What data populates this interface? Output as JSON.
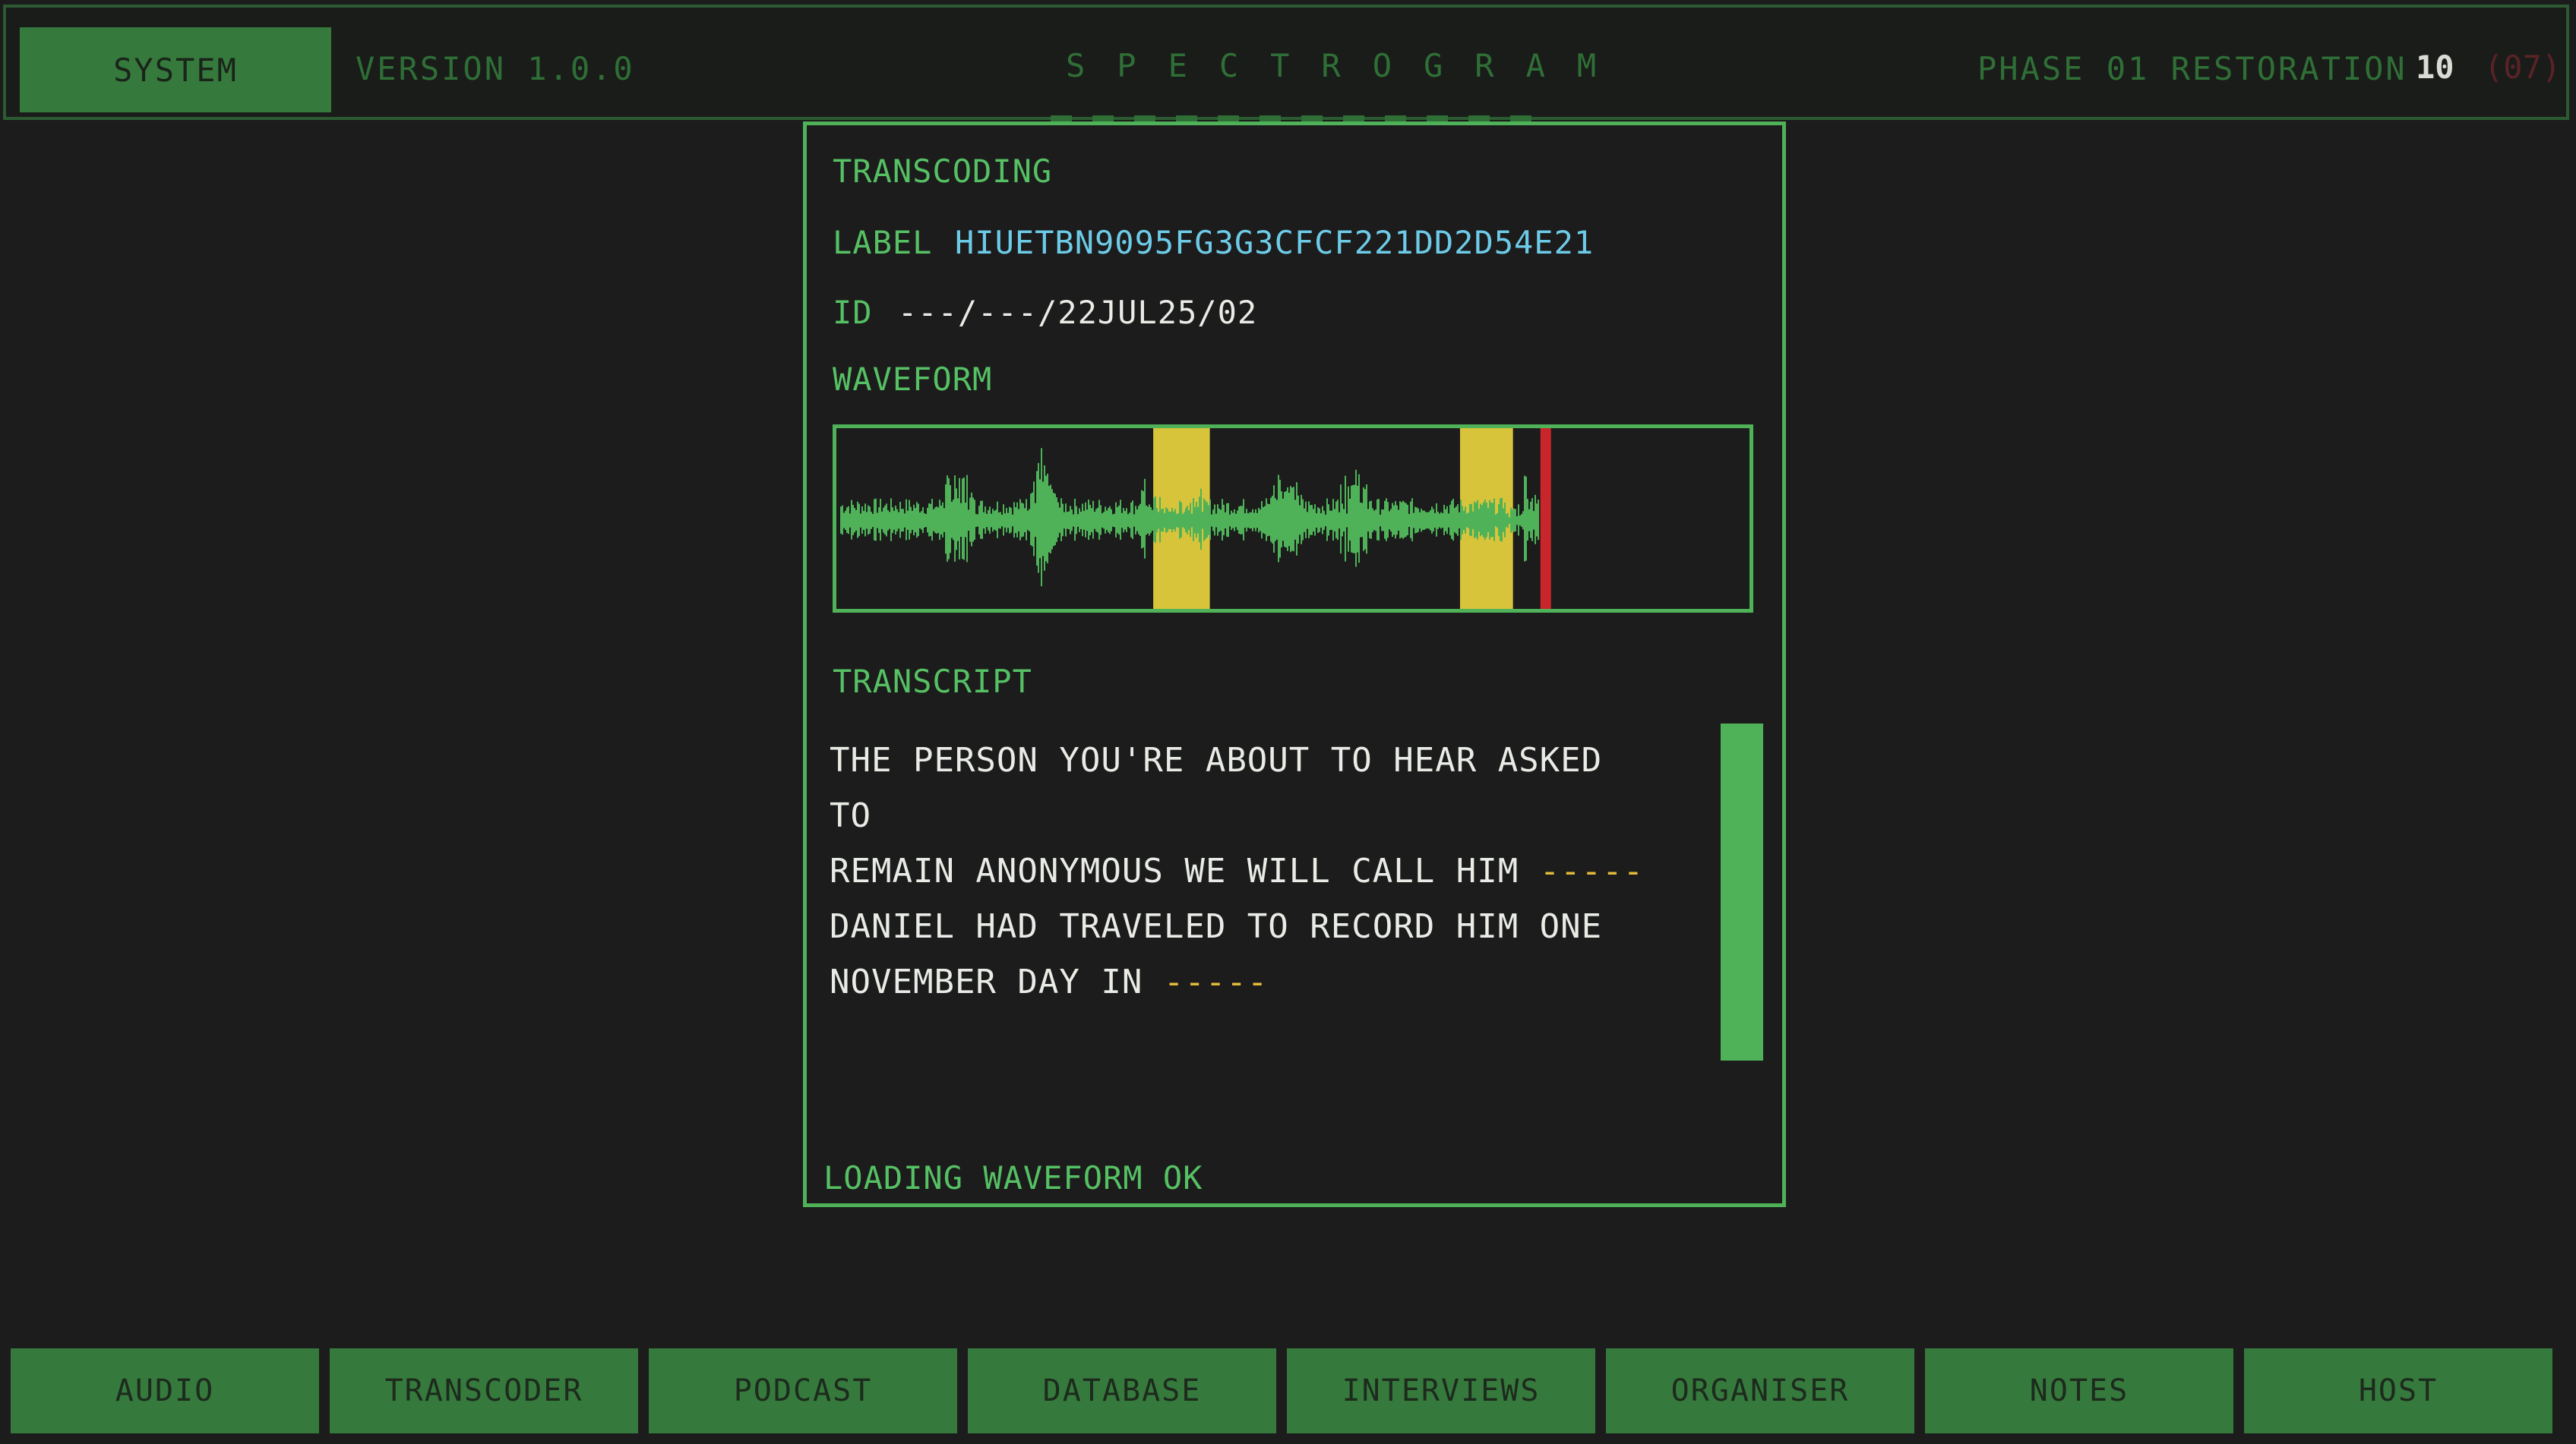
{
  "header": {
    "system_label": "SYSTEM",
    "version": "VERSION 1.0.0",
    "title": "SPECTROGRAM",
    "phase": "PHASE 01 RESTORATION",
    "count": "10",
    "count_extra": "(07)"
  },
  "panel": {
    "section_title": "TRANSCODING",
    "label_key": "LABEL",
    "label_value": "HIUETBN9095FG3G3CFCF221DD2D54E21",
    "id_key": "ID",
    "id_value": "---/---/22JUL25/02",
    "waveform_title": "WAVEFORM",
    "transcript_title": "TRANSCRIPT",
    "transcript": {
      "line1": "THE PERSON YOU'RE ABOUT TO HEAR ASKED TO",
      "line2": "REMAIN ANONYMOUS WE WILL CALL HIM",
      "line2_redaction": "-----",
      "line3": "DANIEL HAD TRAVELED TO RECORD HIM ONE",
      "line4": "NOVEMBER DAY IN",
      "line4_redaction": "-----"
    },
    "status": "LOADING WAVEFORM OK"
  },
  "waveform": {
    "played_fraction": 0.77,
    "highlight_segments": [
      [
        0.347,
        0.409
      ],
      [
        0.683,
        0.741
      ]
    ],
    "playhead_fraction": 0.771
  },
  "tabs": [
    "AUDIO",
    "TRANSCODER",
    "PODCAST",
    "DATABASE",
    "INTERVIEWS",
    "ORGANISER",
    "NOTES",
    "HOST"
  ],
  "colors": {
    "accent_green": "#4fb259",
    "dim_green": "#2f6f36",
    "label_cyan": "#6ecbe8",
    "highlight_yellow": "#d8c43a",
    "playhead_red": "#c8262a",
    "redaction_yellow": "#e2b93a"
  }
}
